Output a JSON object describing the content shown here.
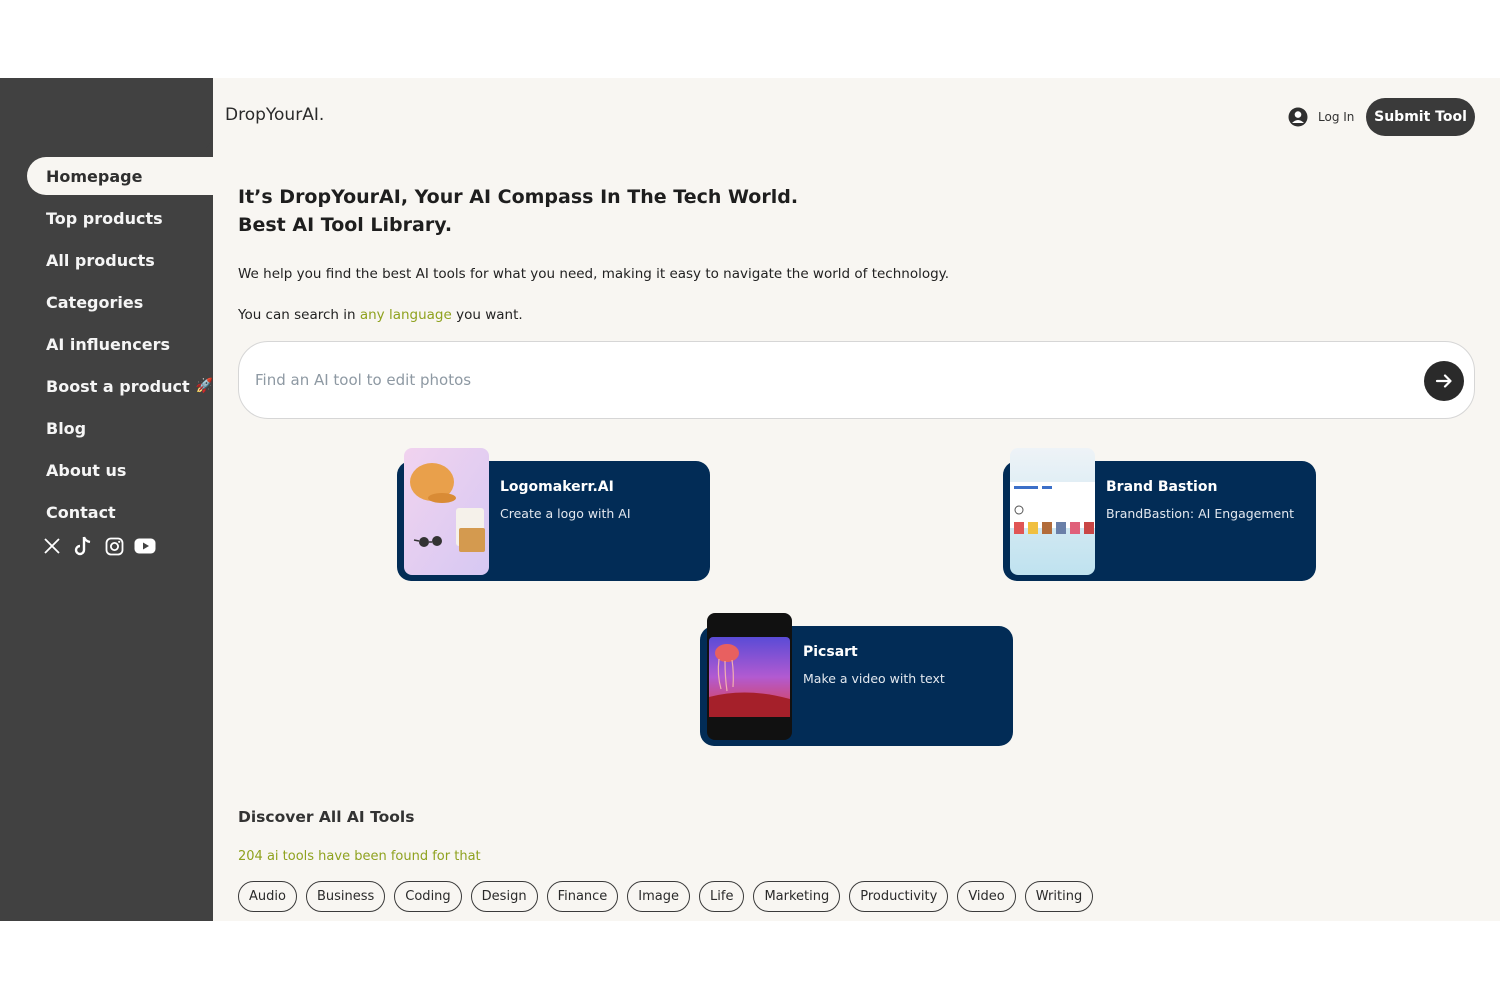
{
  "header": {
    "brand": "DropYourAI.",
    "login_label": "Log In",
    "submit_label": "Submit Tool"
  },
  "sidebar": {
    "items": [
      {
        "label": "Homepage",
        "active": true
      },
      {
        "label": "Top products"
      },
      {
        "label": "All products"
      },
      {
        "label": "Categories"
      },
      {
        "label": "AI influencers"
      },
      {
        "label": "Boost a product",
        "icon": "rocket-icon"
      },
      {
        "label": "Blog"
      },
      {
        "label": "About us"
      },
      {
        "label": "Contact"
      }
    ],
    "socials": [
      "x-icon",
      "tiktok-icon",
      "instagram-icon",
      "youtube-icon"
    ]
  },
  "hero": {
    "title_line1": "It’s DropYourAI, Your AI Compass In The Tech World.",
    "title_line2": "Best AI Tool Library.",
    "description": "We help you find the best AI tools for what you need, making it easy to navigate the world of technology.",
    "lang_prefix": "You can search in ",
    "lang_accent": "any language",
    "lang_suffix": " you want."
  },
  "search": {
    "placeholder": "Find an AI tool to edit photos",
    "value": ""
  },
  "featured": [
    {
      "title": "Logomakerr.AI",
      "subtitle": "Create a logo with AI"
    },
    {
      "title": "Brand Bastion",
      "subtitle": "BrandBastion: AI Engagement"
    },
    {
      "title": "Picsart",
      "subtitle": "Make a video with text"
    }
  ],
  "discover": {
    "title": "Discover All AI Tools",
    "count_text": "204 ai tools have been found for that",
    "categories": [
      "Audio",
      "Business",
      "Coding",
      "Design",
      "Finance",
      "Image",
      "Life",
      "Marketing",
      "Productivity",
      "Video",
      "Writing"
    ]
  },
  "colors": {
    "sidebar": "#414141",
    "background": "#f8f6f2",
    "card": "#022c56",
    "accent": "#8fa21f"
  }
}
